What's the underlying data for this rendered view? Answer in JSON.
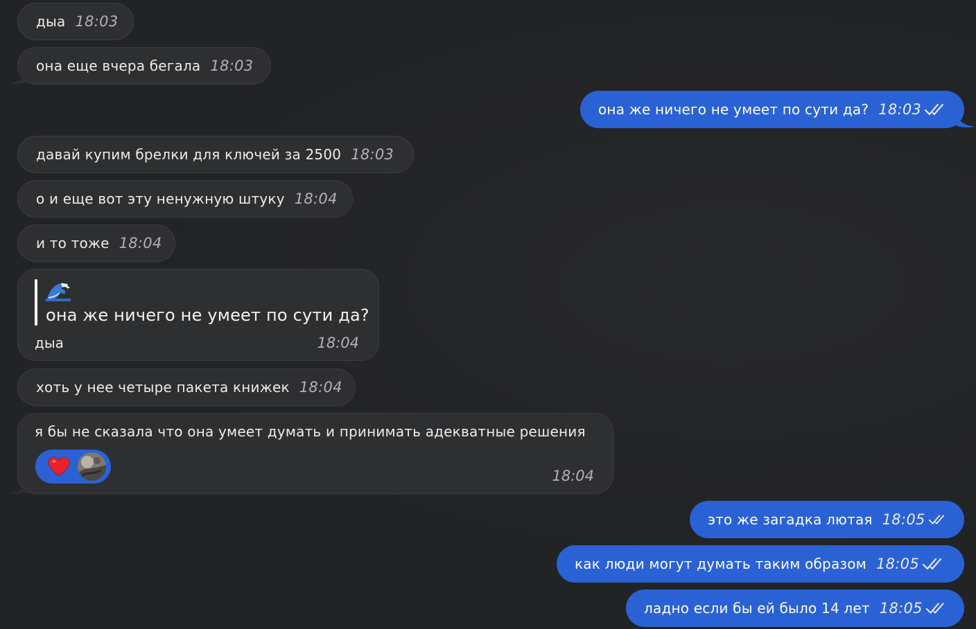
{
  "colors": {
    "background": "#222325",
    "incoming_bubble": "#2e2f31",
    "outgoing_bubble": "#2a62d6",
    "incoming_time": "#b2b2b6",
    "outgoing_time": "#e7ecff"
  },
  "messages": [
    {
      "text": "дыа",
      "time": "18:03"
    },
    {
      "text": "она еще вчера бегала",
      "time": "18:03"
    },
    {
      "text": "она же ничего не умеет по сути да?",
      "time": "18:03",
      "status_icon": "double-check-icon"
    },
    {
      "text": "давай купим брелки для ключей за 2500",
      "time": "18:03"
    },
    {
      "text": "о и еще вот эту ненужную штуку",
      "time": "18:04"
    },
    {
      "text": "и то тоже",
      "time": "18:04"
    },
    {
      "reply": {
        "emoji_icon": "wave-emoji-icon",
        "quoted_text": "она же ничего не умеет по сути да?"
      },
      "text": "дыа",
      "time": "18:04"
    },
    {
      "text": "хоть у нее четыре пакета книжек",
      "time": "18:04"
    },
    {
      "text": "я бы не сказала что она умеет думать и принимать адекватные решения",
      "time": "18:04",
      "reaction": {
        "icon": "heart-icon",
        "user_icon": "avatar"
      }
    },
    {
      "text": "это же загадка лютая",
      "time": "18:05",
      "status_icon": "double-check-icon"
    },
    {
      "text": "как люди могут думать таким образом",
      "time": "18:05",
      "status_icon": "double-check-icon"
    },
    {
      "text": "ладно если бы ей было 14 лет",
      "time": "18:05",
      "status_icon": "double-check-icon"
    }
  ]
}
